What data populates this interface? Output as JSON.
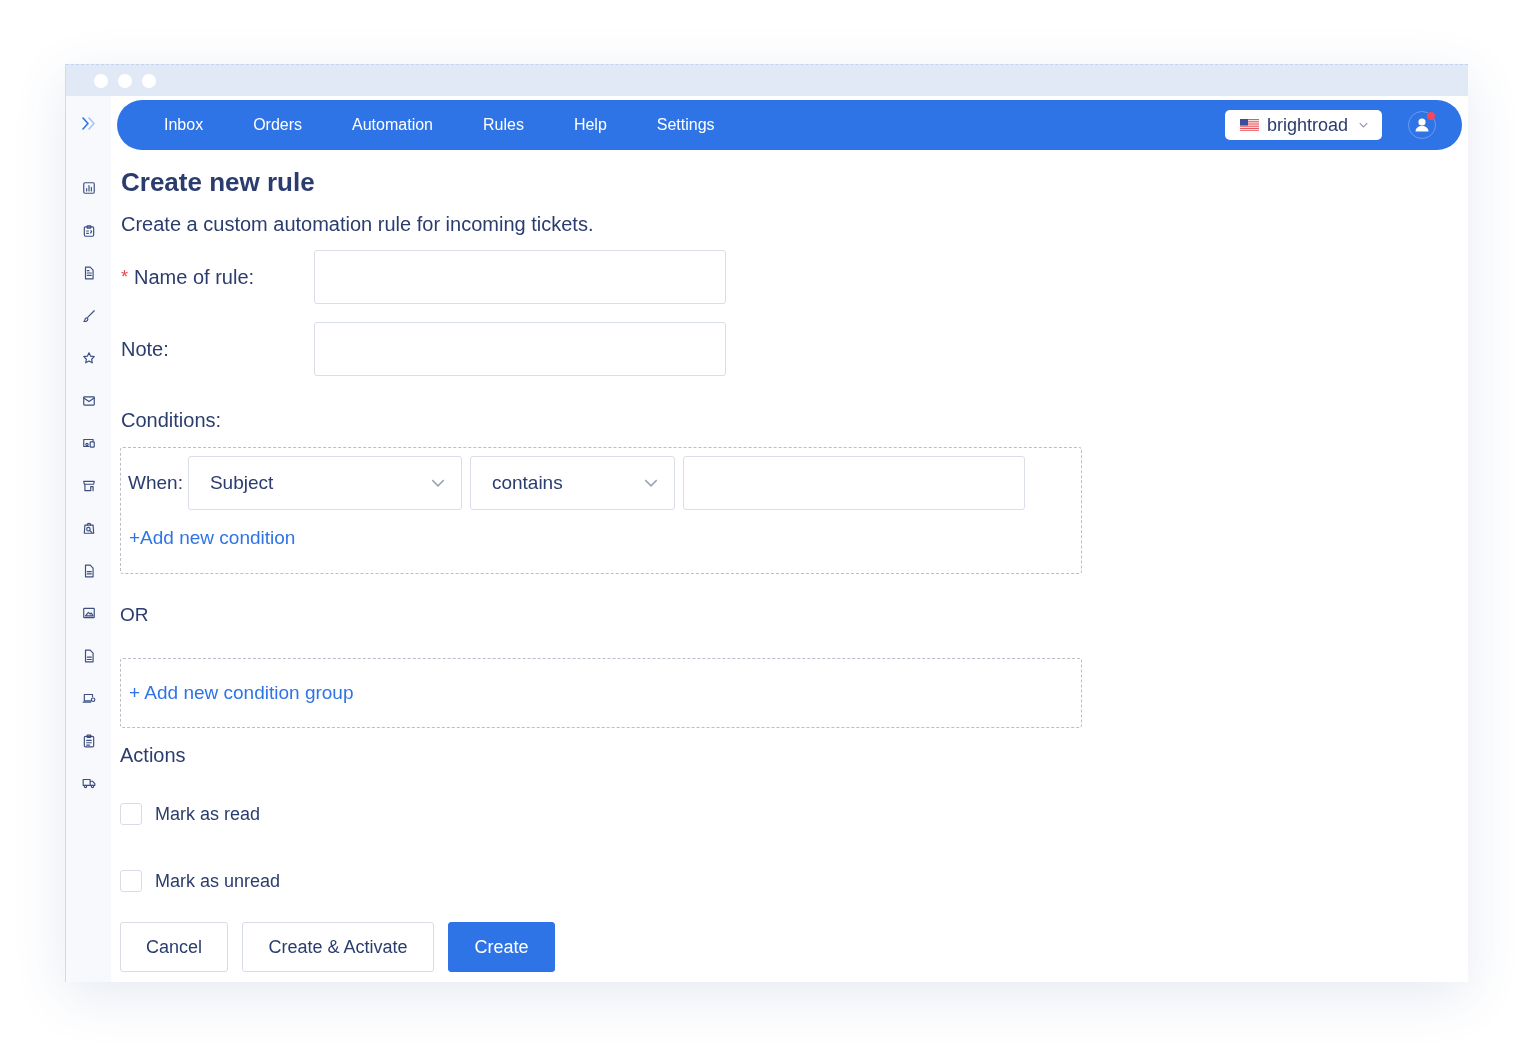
{
  "nav": {
    "items": [
      {
        "label": "Inbox"
      },
      {
        "label": "Orders"
      },
      {
        "label": "Automation"
      },
      {
        "label": "Rules"
      },
      {
        "label": "Help"
      },
      {
        "label": "Settings"
      }
    ]
  },
  "account": {
    "org": "brightroad",
    "notification": true
  },
  "form": {
    "title": "Create new rule",
    "subtitle": "Create a custom automation rule for incoming tickets.",
    "fields": [
      {
        "label": "Name of rule:",
        "required_mark": "*"
      },
      {
        "label": "Note:"
      }
    ]
  },
  "conditions": {
    "label": "Conditions:",
    "groups": [
      {
        "when_label": "When:",
        "rows": [
          {
            "field": "Subject",
            "operator": "contains"
          }
        ],
        "add_condition": "+Add new condition"
      }
    ],
    "separator": "OR",
    "add_group": "+ Add new condition group"
  },
  "actions": {
    "label": "Actions",
    "items": [
      {
        "label": "Mark as read",
        "checked": false
      },
      {
        "label": "Mark as unread",
        "checked": false
      }
    ]
  },
  "buttons": [
    {
      "label": "Cancel",
      "kind": "secondary"
    },
    {
      "label": "Create & Activate",
      "kind": "secondary"
    },
    {
      "label": "Create",
      "kind": "primary"
    }
  ]
}
